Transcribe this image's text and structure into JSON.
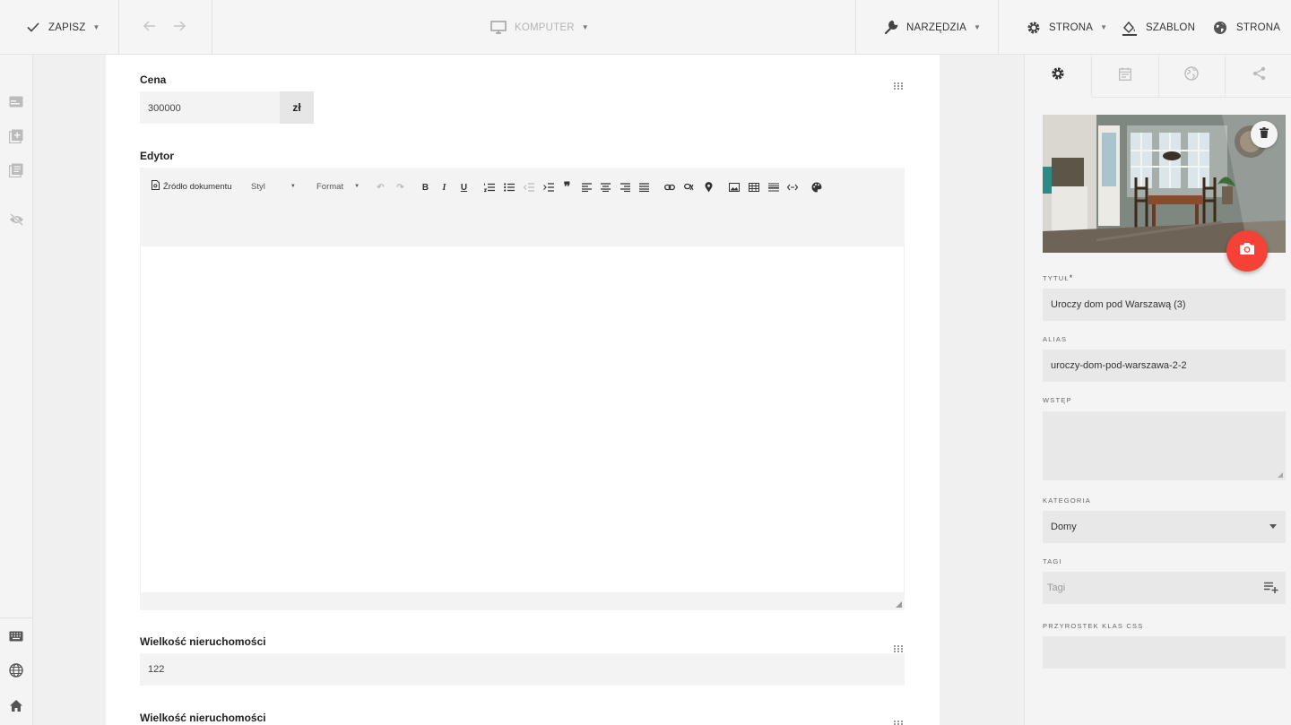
{
  "toolbar": {
    "save_label": "ZAPISZ",
    "device_label": "KOMPUTER",
    "tools_label": "NARZĘDZIA",
    "page_label": "STRONA",
    "template_label": "SZABLON",
    "site_label": "STRONA"
  },
  "fields": {
    "price": {
      "label": "Cena",
      "value": "300000",
      "suffix": "zł"
    },
    "editor": {
      "label": "Edytor",
      "source_label": "Źródło dokumentu",
      "style_label": "Styl",
      "format_label": "Format"
    },
    "property_size": {
      "label": "Wielkość nieruchomości",
      "value": "122"
    },
    "property_size_2": {
      "label": "Wielkość nieruchomości"
    }
  },
  "panel": {
    "title": {
      "label": "TYTUŁ",
      "required": "*",
      "value": "Uroczy dom pod Warszawą (3)"
    },
    "alias": {
      "label": "ALIAS",
      "value": "uroczy-dom-pod-warszawa-2-2"
    },
    "intro": {
      "label": "WSTĘP",
      "value": ""
    },
    "category": {
      "label": "KATEGORIA",
      "value": "Domy"
    },
    "tags": {
      "label": "TAGI",
      "placeholder": "Tagi"
    },
    "css_suffix": {
      "label": "PRZYROSTEK KLAS CSS",
      "value": ""
    }
  },
  "colors": {
    "accent_camera": "#f44336",
    "topbar_bg": "#f5f5f5",
    "panel_input_bg": "#e8e8e8"
  },
  "icons": {
    "toolbar": [
      "check-icon",
      "arrow-left-icon",
      "arrow-right-icon",
      "monitor-icon",
      "wrench-icon",
      "gear-icon",
      "paint-bucket-icon",
      "globe-icon"
    ],
    "left_rail": [
      "card-icon",
      "add-box-icon",
      "list-icon",
      "eye-off-icon",
      "keyboard-icon",
      "globe-icon",
      "home-icon"
    ],
    "panel_tabs": [
      "gear-icon",
      "calendar-icon",
      "globe-icon",
      "share-icon"
    ]
  }
}
